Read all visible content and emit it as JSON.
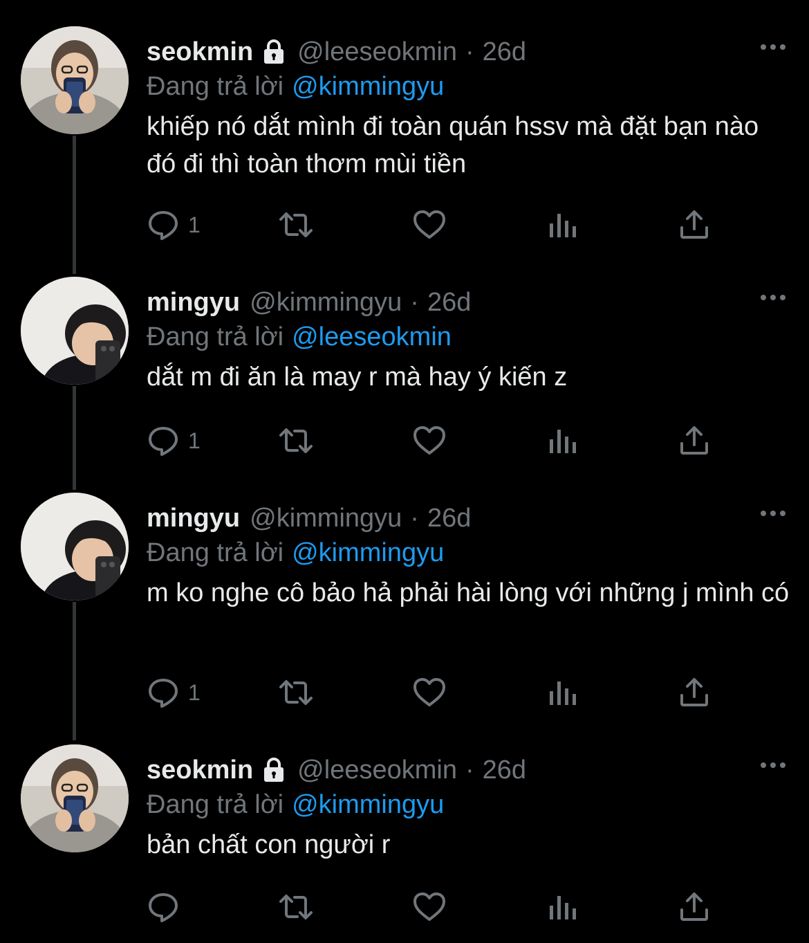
{
  "colors": {
    "background": "#000000",
    "text_primary": "#e7e9ea",
    "text_secondary": "#71767b",
    "mention": "#1d9bf0",
    "thread_line": "#333639"
  },
  "tweets": [
    {
      "display_name": "seokmin",
      "protected": true,
      "handle": "@leeseokmin",
      "separator": "·",
      "time": "26d",
      "reply_label": "Đang trả lời",
      "reply_to": "@kimmingyu",
      "text": "khiếp nó dắt mình đi toàn quán hssv mà đặt bạn nào đó đi thì toàn thơm mùi tiền",
      "reply_count": "1",
      "avatar_icon": "avatar-photo-icon"
    },
    {
      "display_name": "mingyu",
      "protected": false,
      "handle": "@kimmingyu",
      "separator": "·",
      "time": "26d",
      "reply_label": "Đang trả lời",
      "reply_to": "@leeseokmin",
      "text": "dắt m đi ăn là may r mà hay ý kiến z",
      "reply_count": "1",
      "avatar_icon": "avatar-photo-icon"
    },
    {
      "display_name": "mingyu",
      "protected": false,
      "handle": "@kimmingyu",
      "separator": "·",
      "time": "26d",
      "reply_label": "Đang trả lời",
      "reply_to": "@kimmingyu",
      "text": "m ko nghe cô bảo hả phải hài lòng với những j mình có",
      "reply_count": "1",
      "avatar_icon": "avatar-photo-icon"
    },
    {
      "display_name": "seokmin",
      "protected": true,
      "handle": "@leeseokmin",
      "separator": "·",
      "time": "26d",
      "reply_label": "Đang trả lời",
      "reply_to": "@kimmingyu",
      "text": "bản chất con người r",
      "reply_count": "",
      "avatar_icon": "avatar-photo-icon"
    }
  ],
  "action_icons": [
    "reply-icon",
    "retweet-icon",
    "like-icon",
    "analytics-icon",
    "share-icon"
  ]
}
